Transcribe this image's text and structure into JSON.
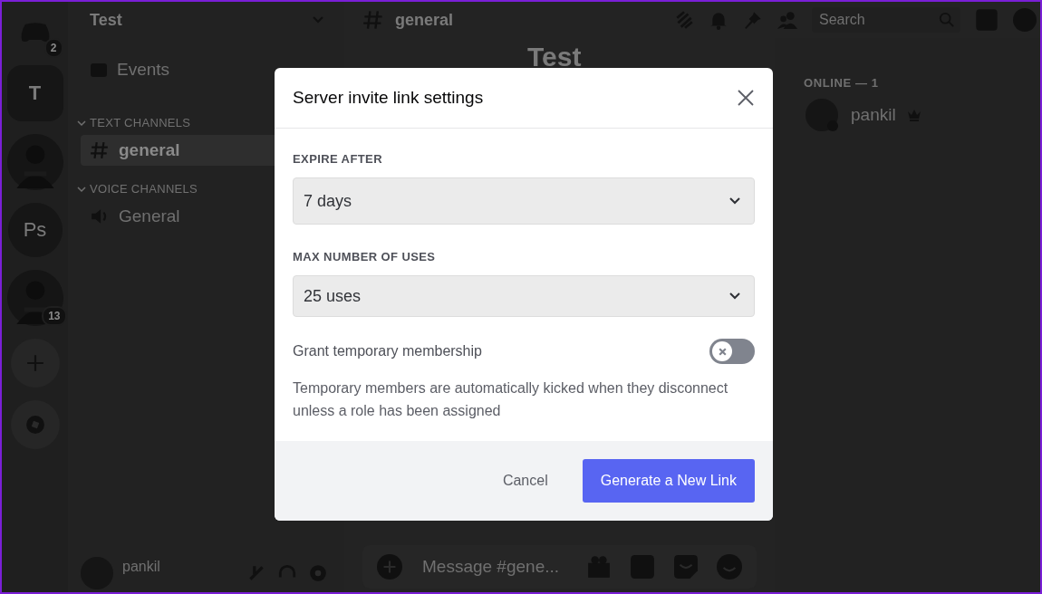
{
  "servers": [
    {
      "kind": "home",
      "badge": "2"
    },
    {
      "kind": "letter",
      "label": "T"
    },
    {
      "kind": "picture"
    },
    {
      "kind": "letter",
      "label": "Ps"
    },
    {
      "kind": "picture",
      "badge": "13"
    },
    {
      "kind": "add"
    },
    {
      "kind": "explore"
    }
  ],
  "sidebar": {
    "server_name": "Test",
    "events": "Events",
    "categories": [
      {
        "name": "TEXT CHANNELS",
        "channels": [
          {
            "kind": "text",
            "name": "general",
            "selected": true
          }
        ]
      },
      {
        "name": "VOICE CHANNELS",
        "channels": [
          {
            "kind": "voice",
            "name": "General",
            "selected": false
          }
        ]
      }
    ],
    "user": {
      "name": "pankil"
    }
  },
  "header": {
    "channel": "general",
    "search": {
      "placeholder": "Search"
    }
  },
  "chat": {
    "heading": "Test",
    "composer": {
      "placeholder": "Message #gene..."
    }
  },
  "members": {
    "heading": "ONLINE — 1",
    "items": [
      {
        "name": "pankil",
        "owner": true
      }
    ]
  },
  "modal": {
    "title": "Server invite link settings",
    "fields": [
      {
        "label": "EXPIRE AFTER",
        "value": "7 days"
      },
      {
        "label": "MAX NUMBER OF USES",
        "value": "25 uses"
      }
    ],
    "toggle": {
      "label": "Grant temporary membership",
      "on": false
    },
    "help": "Temporary members are automatically kicked when they disconnect unless a role has been assigned",
    "buttons": [
      {
        "kind": "secondary",
        "label": "Cancel"
      },
      {
        "kind": "primary",
        "label": "Generate a New Link"
      }
    ]
  }
}
